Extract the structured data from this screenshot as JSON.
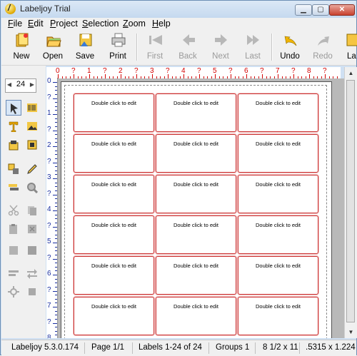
{
  "window": {
    "title": "Labeljoy Trial"
  },
  "menu": [
    {
      "label": "File",
      "key": "F",
      "rest": "ile"
    },
    {
      "label": "Edit",
      "key": "E",
      "rest": "dit"
    },
    {
      "label": "Project",
      "key": "P",
      "rest": "roject"
    },
    {
      "label": "Selection",
      "key": "S",
      "rest": "election"
    },
    {
      "label": "Zoom",
      "key": "Z",
      "rest": "oom"
    },
    {
      "label": "Help",
      "key": "H",
      "rest": "elp"
    }
  ],
  "toolbar": {
    "new": "New",
    "open": "Open",
    "save": "Save",
    "print": "Print",
    "first": "First",
    "back": "Back",
    "next": "Next",
    "last": "Last",
    "undo": "Undo",
    "redo": "Redo",
    "overflow": "La"
  },
  "zoom_spinner": {
    "value": "24"
  },
  "ruler_h": [
    "0",
    "?",
    "1",
    "?",
    "2",
    "?",
    "3",
    "?",
    "4",
    "?",
    "5",
    "?",
    "6",
    "?",
    "7",
    "?",
    "8",
    "?"
  ],
  "ruler_v": [
    "0",
    "?",
    "1",
    "?",
    "2",
    "?",
    "3",
    "?",
    "4",
    "?",
    "5",
    "?",
    "6",
    "?",
    "7",
    "?",
    "8"
  ],
  "labels": {
    "placeholder": "Double click to edit",
    "cells": [
      "Double click to edit",
      "Double click to edit",
      "Double click to edit",
      "Double click to edit",
      "Double click to edit",
      "Double click to edit",
      "Double click to edit",
      "Double click to edit",
      "Double click to edit",
      "Double click to edit",
      "Double click to edit",
      "Double click to edit",
      "Double click to edit",
      "Double click to edit",
      "Double click to edit",
      "Double click to edit",
      "Double click to edit",
      "Double click to edit"
    ]
  },
  "status": {
    "version": "Labeljoy 5.3.0.174",
    "page": "Page 1/1",
    "labels": "Labels 1-24 of 24",
    "groups": "Groups 1",
    "paper": "8 1/2 x 11",
    "label_size": ".5315 x 1.224"
  },
  "colors": {
    "ruler_h": "#d40000",
    "ruler_v": "#1a2fa0",
    "label_border": "#cc3333"
  }
}
